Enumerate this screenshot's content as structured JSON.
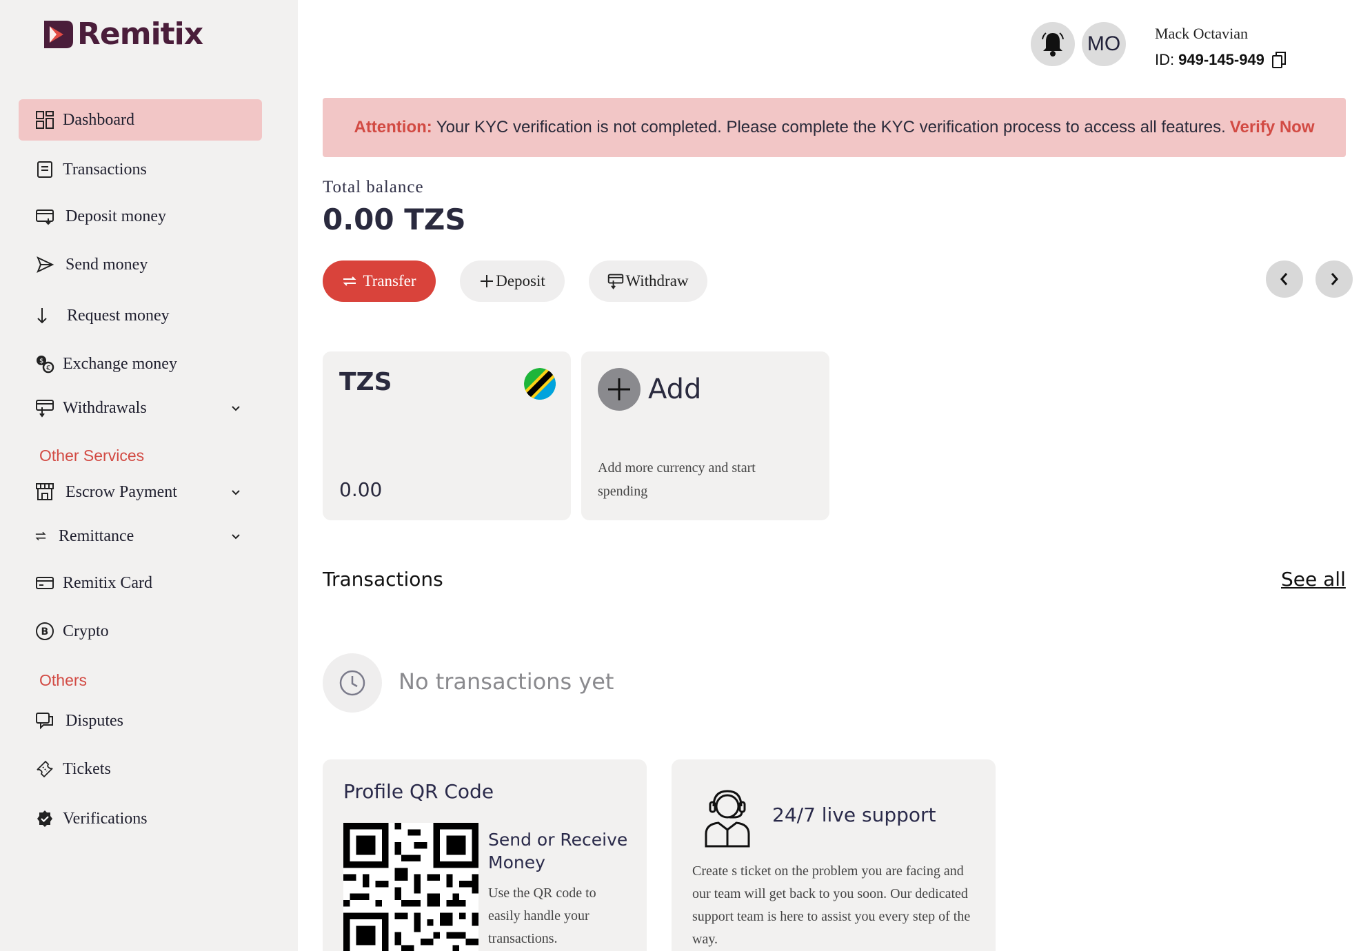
{
  "brand": {
    "name": "Remitix",
    "accent": "#d9433b",
    "logo_color": "#4a1d3a"
  },
  "sidebar": {
    "items": [
      {
        "label": "Dashboard",
        "icon": "dashboard-grid-icon",
        "active": true
      },
      {
        "label": "Transactions",
        "icon": "transactions-list-icon"
      },
      {
        "label": "Deposit money",
        "icon": "deposit-card-icon"
      },
      {
        "label": "Send money",
        "icon": "send-arrow-icon"
      },
      {
        "label": "Request money",
        "icon": "arrow-down-icon"
      },
      {
        "label": "Exchange money",
        "icon": "exchange-coins-icon"
      },
      {
        "label": "Withdrawals",
        "icon": "withdraw-icon",
        "expandable": true
      }
    ],
    "other_services_title": "Other Services",
    "other_services": [
      {
        "label": "Escrow Payment",
        "icon": "store-icon",
        "expandable": true
      },
      {
        "label": "Remittance",
        "icon": "swap-arrows-icon",
        "expandable": true
      },
      {
        "label": "Remitix Card",
        "icon": "credit-card-icon"
      },
      {
        "label": "Crypto",
        "icon": "bitcoin-icon"
      }
    ],
    "others_title": "Others",
    "others": [
      {
        "label": "Disputes",
        "icon": "chat-bubbles-icon"
      },
      {
        "label": "Tickets",
        "icon": "ticket-icon"
      },
      {
        "label": "Verifications",
        "icon": "verified-badge-icon"
      }
    ]
  },
  "header": {
    "avatar_initials": "MO",
    "user_name": "Mack Octavian",
    "id_label": "ID:",
    "id_value": "949-145-949"
  },
  "alert": {
    "prefix": "Attention:",
    "message": "Your KYC verification is not completed. Please complete the KYC verification process to access all features.",
    "link": "Verify Now"
  },
  "balance": {
    "label": "Total balance",
    "value": "0.00 TZS"
  },
  "actions": {
    "transfer": "Transfer",
    "deposit": "Deposit",
    "withdraw": "Withdraw"
  },
  "wallets": {
    "tzs": {
      "code": "TZS",
      "amount": "0.00",
      "flag": "tanzania-flag-icon"
    },
    "add": {
      "label": "Add",
      "description": "Add more currency and start spending"
    }
  },
  "transactions": {
    "title": "Transactions",
    "see_all": "See all",
    "empty": "No transactions yet"
  },
  "qr_card": {
    "title": "Profile QR Code",
    "subtitle": "Send or Receive Money",
    "description": "Use the QR code to easily handle your transactions."
  },
  "support_card": {
    "title": "24/7 live support",
    "description": "Create s ticket on the problem you are facing and our team will get back to you soon. Our dedicated support team is here to assist you every step of the way."
  }
}
